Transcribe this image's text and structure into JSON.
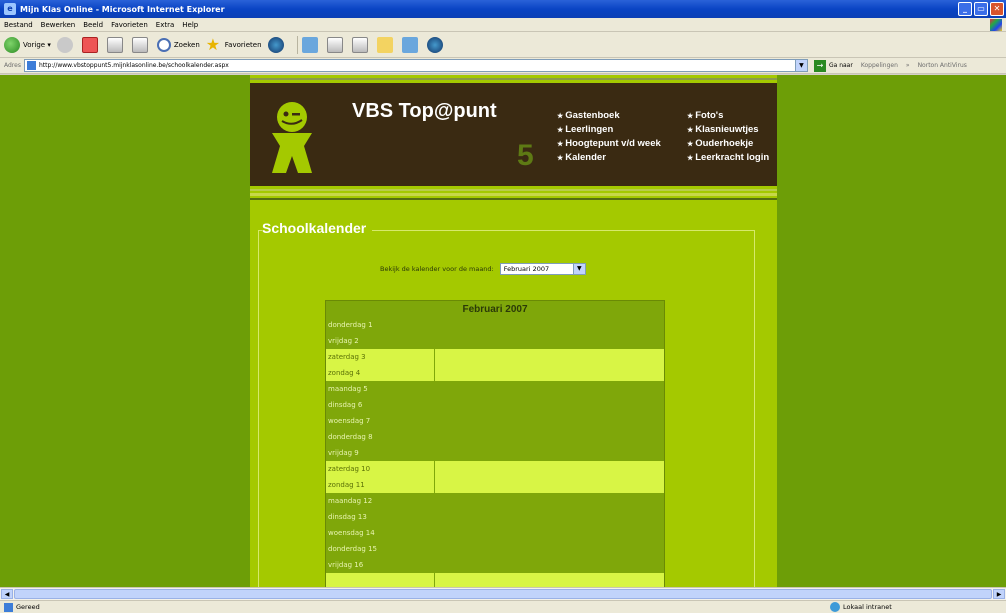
{
  "window": {
    "title": "Mijn Klas Online - Microsoft Internet Explorer"
  },
  "menu": [
    "Bestand",
    "Bewerken",
    "Beeld",
    "Favorieten",
    "Extra",
    "Help"
  ],
  "toolbar": {
    "back_label": "Vorige",
    "search_label": "Zoeken",
    "favorites_label": "Favorieten"
  },
  "address": {
    "label": "Adres",
    "url": "http://www.vbstoppunt5.mijnklasonline.be/schoolkalender.aspx",
    "go_label": "Ga naar",
    "links_label": "Koppelingen",
    "norton_label": "Norton AntiVirus"
  },
  "site": {
    "title": "VBS Top@punt",
    "class_number": "5",
    "nav_left": [
      "Gastenboek",
      "Leerlingen",
      "Hoogtepunt v/d week",
      "Kalender"
    ],
    "nav_right": [
      "Foto's",
      "Klasnieuwtjes",
      "Ouderhoekje",
      "Leerkracht login"
    ]
  },
  "content": {
    "page_title": "Schoolkalender",
    "filter_label": "Bekijk de kalender voor de maand:",
    "selected_month": "Februari 2007",
    "calendar_title": "Februari 2007",
    "days": [
      {
        "label": "donderdag 1",
        "weekend": false
      },
      {
        "label": "vrijdag 2",
        "weekend": false
      },
      {
        "label": "zaterdag 3",
        "weekend": true
      },
      {
        "label": "zondag 4",
        "weekend": true
      },
      {
        "label": "maandag 5",
        "weekend": false
      },
      {
        "label": "dinsdag 6",
        "weekend": false
      },
      {
        "label": "woensdag 7",
        "weekend": false
      },
      {
        "label": "donderdag 8",
        "weekend": false
      },
      {
        "label": "vrijdag 9",
        "weekend": false
      },
      {
        "label": "zaterdag 10",
        "weekend": true
      },
      {
        "label": "zondag 11",
        "weekend": true
      },
      {
        "label": "maandag 12",
        "weekend": false
      },
      {
        "label": "dinsdag 13",
        "weekend": false
      },
      {
        "label": "woensdag 14",
        "weekend": false
      },
      {
        "label": "donderdag 15",
        "weekend": false
      },
      {
        "label": "vrijdag 16",
        "weekend": false
      },
      {
        "label": "",
        "weekend": true
      }
    ]
  },
  "status": {
    "left": "Gereed",
    "zone": "Lokaal intranet"
  },
  "colors": {
    "page_bg": "#6d9e07",
    "site_bg": "#a4c900",
    "header_bg": "#3a2a12",
    "weekend_row": "#d8f545"
  }
}
